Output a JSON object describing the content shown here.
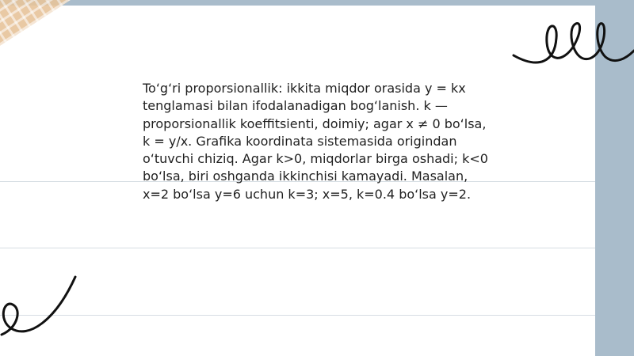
{
  "note": {
    "lines": [
      "To‘g‘ri proporsionallik: ikkita miqdor orasida y = kx",
      "tenglamasi bilan ifodalanadigan bog‘lanish. k —",
      "proporsionallik koeffitsienti, doimiy; agar x ≠ 0 bo‘lsa,",
      "k = y/x. Grafika koordinata sistemasida origindan",
      "o‘tuvchi chiziq. Agar k>0, miqdorlar birga oshadi; k<0",
      "bo‘lsa, biri oshganda ikkinchisi kamayadi. Masalan,",
      "x=2 bo‘lsa y=6 uchun k=3; x=5, k=0.4 bo‘lsa y=2."
    ]
  },
  "decor": {
    "paper_color": "#ffffff",
    "background_color": "#a9bccb",
    "tape_color": "#e7c49b",
    "ink_color": "#111111",
    "icons": [
      "tape-strip",
      "loop-scribble-top-right",
      "loop-scribble-bottom-left"
    ]
  }
}
